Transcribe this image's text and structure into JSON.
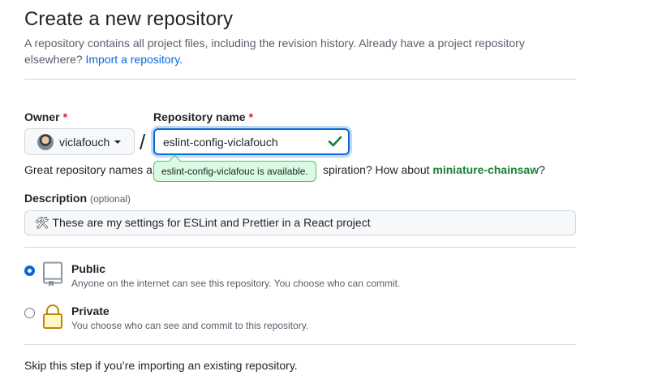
{
  "header": {
    "title": "Create a new repository",
    "subtitle": "A repository contains all project files, including the revision history. Already have a project repository elsewhere?",
    "import_link": "Import a repository."
  },
  "owner": {
    "label": "Owner",
    "required_mark": "*",
    "value": "viclafouch"
  },
  "separator": "/",
  "repo_name": {
    "label": "Repository name",
    "required_mark": "*",
    "value": "eslint-config-viclafouch",
    "tooltip": "eslint-config-viclafouc is available."
  },
  "hint": {
    "prefix": "Great repository names a",
    "middle": "spiration? How about",
    "suggestion": "miniature-chainsaw",
    "suffix": "?"
  },
  "description": {
    "label": "Description",
    "optional_label": "(optional)",
    "value": "🛠 These are my settings for ESLint and Prettier in a React project"
  },
  "visibility": [
    {
      "title": "Public",
      "description": "Anyone on the internet can see this repository. You choose who can commit.",
      "checked": true,
      "icon": "repo-icon"
    },
    {
      "title": "Private",
      "description": "You choose who can see and commit to this repository.",
      "checked": false,
      "icon": "lock-icon"
    }
  ],
  "template_note": "Skip this step if you’re importing an existing repository.",
  "colors": {
    "accent": "#0969da",
    "success": "#1a7f37",
    "tooltip_bg": "#dafbe1",
    "required": "#cf222e"
  }
}
